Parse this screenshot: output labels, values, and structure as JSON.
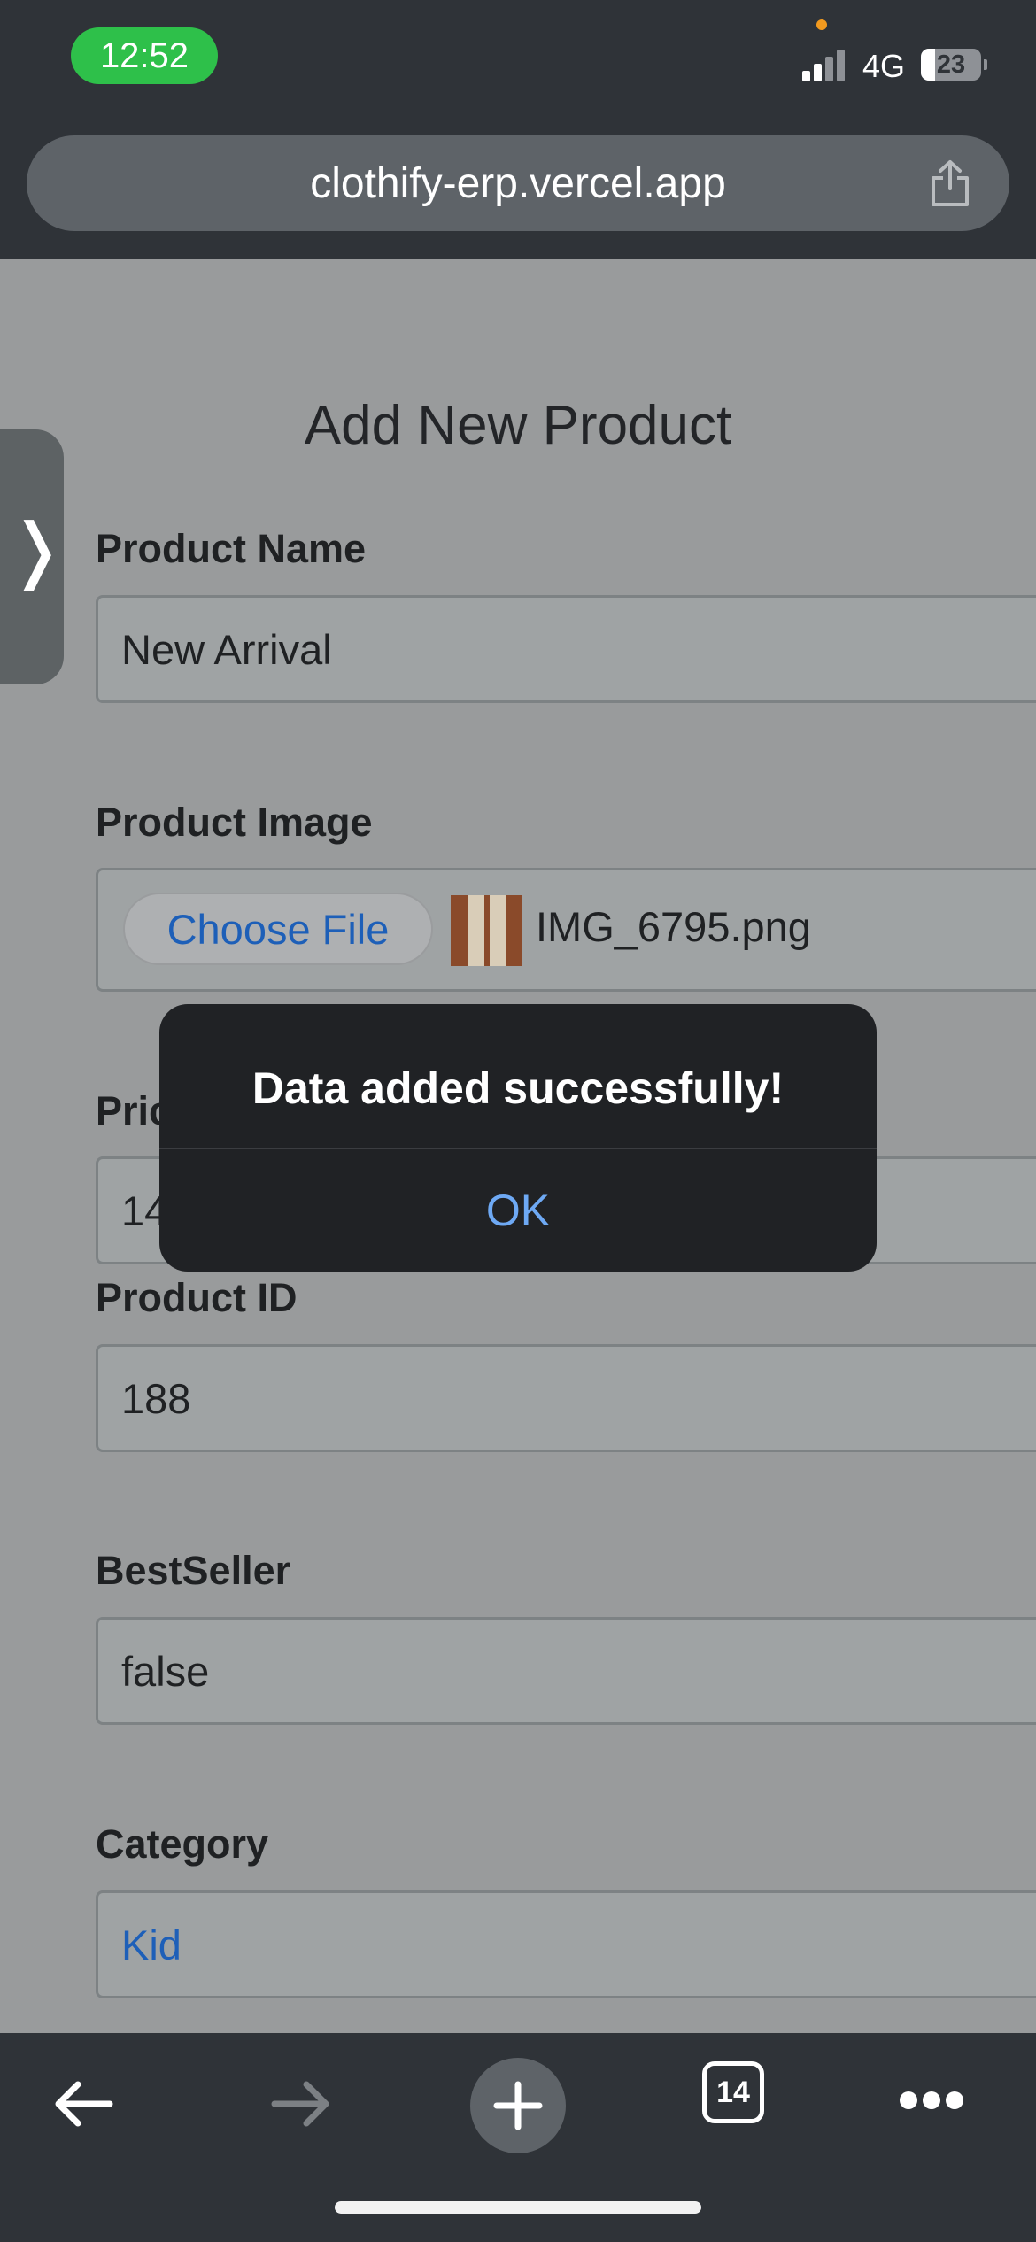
{
  "status_bar": {
    "time": "12:52",
    "network": "4G",
    "battery": "23"
  },
  "browser": {
    "url": "clothify-erp.vercel.app",
    "tab_count": "14"
  },
  "form": {
    "title": "Add New Product",
    "product_name": {
      "label": "Product Name",
      "value": "New Arrival"
    },
    "product_image": {
      "label": "Product Image",
      "button": "Choose File",
      "filename": "IMG_6795.png"
    },
    "price": {
      "label": "Pric",
      "value": "14"
    },
    "product_id": {
      "label": "Product ID",
      "value": "188"
    },
    "bestseller": {
      "label": "BestSeller",
      "value": "false"
    },
    "category": {
      "label": "Category",
      "value": "Kid"
    }
  },
  "dialog": {
    "message": "Data added successfully!",
    "ok": "OK"
  },
  "icons": [
    "chevron-right-icon",
    "share-icon",
    "back-arrow-icon",
    "forward-arrow-icon",
    "plus-icon",
    "tabs-icon",
    "more-icon"
  ]
}
